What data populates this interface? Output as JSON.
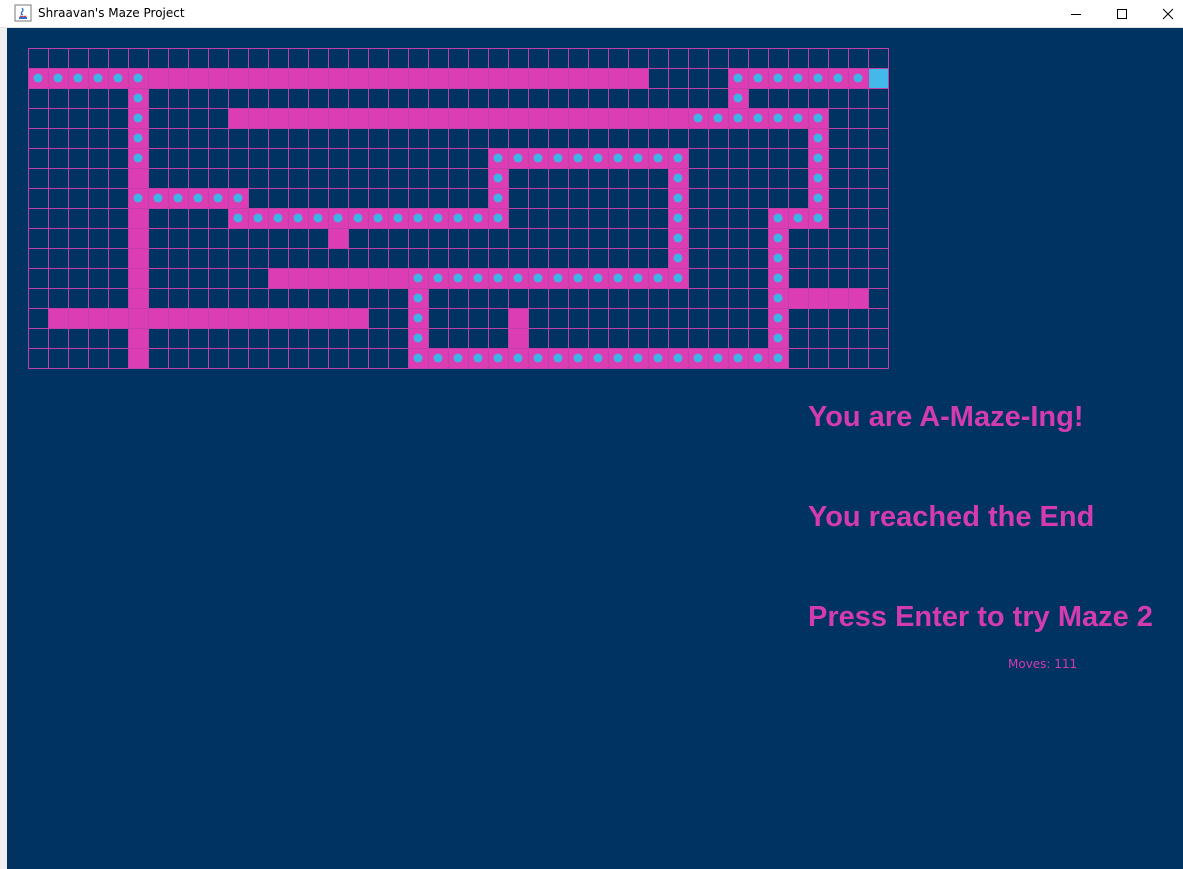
{
  "window": {
    "title": "Shraavan's Maze Project",
    "icon": "java-icon",
    "controls": [
      "minimize-icon",
      "maximize-icon",
      "close-icon"
    ]
  },
  "colors": {
    "background": "#003262",
    "wall": "#dc3cb4",
    "grid": "#c040a8",
    "dot": "#3fb3e6",
    "goal": "#45b8ea",
    "text": "#d43cae"
  },
  "maze": {
    "columns": 43,
    "rows": 16,
    "goal": [
      42,
      1
    ],
    "paths": [
      {
        "row": 1,
        "cols": [
          [
            0,
            30
          ],
          [
            35,
            42
          ]
        ]
      },
      {
        "row": 2,
        "cols": [
          [
            5,
            5
          ],
          [
            35,
            35
          ]
        ]
      },
      {
        "row": 3,
        "cols": [
          [
            5,
            5
          ],
          [
            10,
            39
          ]
        ]
      },
      {
        "row": 4,
        "cols": [
          [
            5,
            5
          ],
          [
            39,
            39
          ]
        ]
      },
      {
        "row": 5,
        "cols": [
          [
            5,
            5
          ],
          [
            23,
            32
          ],
          [
            39,
            39
          ]
        ]
      },
      {
        "row": 6,
        "cols": [
          [
            5,
            5
          ],
          [
            23,
            23
          ],
          [
            32,
            32
          ],
          [
            39,
            39
          ]
        ]
      },
      {
        "row": 7,
        "cols": [
          [
            5,
            10
          ],
          [
            23,
            23
          ],
          [
            32,
            32
          ],
          [
            39,
            39
          ]
        ]
      },
      {
        "row": 8,
        "cols": [
          [
            5,
            5
          ],
          [
            10,
            23
          ],
          [
            32,
            32
          ],
          [
            37,
            39
          ]
        ]
      },
      {
        "row": 9,
        "cols": [
          [
            5,
            5
          ],
          [
            15,
            15
          ],
          [
            32,
            32
          ],
          [
            37,
            37
          ]
        ]
      },
      {
        "row": 10,
        "cols": [
          [
            5,
            5
          ],
          [
            32,
            32
          ],
          [
            37,
            37
          ]
        ]
      },
      {
        "row": 11,
        "cols": [
          [
            5,
            5
          ],
          [
            12,
            32
          ],
          [
            37,
            37
          ]
        ]
      },
      {
        "row": 12,
        "cols": [
          [
            5,
            5
          ],
          [
            19,
            19
          ],
          [
            37,
            41
          ]
        ]
      },
      {
        "row": 13,
        "cols": [
          [
            1,
            16
          ],
          [
            19,
            19
          ],
          [
            24,
            24
          ],
          [
            37,
            37
          ]
        ]
      },
      {
        "row": 14,
        "cols": [
          [
            5,
            5
          ],
          [
            19,
            19
          ],
          [
            24,
            24
          ],
          [
            37,
            37
          ]
        ]
      },
      {
        "row": 15,
        "cols": [
          [
            5,
            5
          ],
          [
            19,
            37
          ]
        ]
      }
    ],
    "trail": [
      {
        "row": 1,
        "cols": [
          [
            0,
            5
          ],
          [
            35,
            41
          ]
        ]
      },
      {
        "row": 2,
        "cols": [
          [
            5,
            5
          ],
          [
            35,
            35
          ]
        ]
      },
      {
        "row": 3,
        "cols": [
          [
            5,
            5
          ],
          [
            33,
            39
          ]
        ]
      },
      {
        "row": 4,
        "cols": [
          [
            5,
            5
          ],
          [
            39,
            39
          ]
        ]
      },
      {
        "row": 5,
        "cols": [
          [
            5,
            5
          ],
          [
            23,
            32
          ],
          [
            39,
            39
          ]
        ]
      },
      {
        "row": 6,
        "cols": [
          [
            23,
            23
          ],
          [
            32,
            32
          ],
          [
            39,
            39
          ]
        ]
      },
      {
        "row": 7,
        "cols": [
          [
            5,
            10
          ],
          [
            23,
            23
          ],
          [
            32,
            32
          ],
          [
            39,
            39
          ]
        ]
      },
      {
        "row": 8,
        "cols": [
          [
            10,
            23
          ],
          [
            32,
            32
          ],
          [
            37,
            39
          ]
        ]
      },
      {
        "row": 9,
        "cols": [
          [
            32,
            32
          ],
          [
            37,
            37
          ]
        ]
      },
      {
        "row": 10,
        "cols": [
          [
            32,
            32
          ],
          [
            37,
            37
          ]
        ]
      },
      {
        "row": 11,
        "cols": [
          [
            19,
            32
          ],
          [
            37,
            37
          ]
        ]
      },
      {
        "row": 12,
        "cols": [
          [
            19,
            19
          ],
          [
            37,
            37
          ]
        ]
      },
      {
        "row": 13,
        "cols": [
          [
            19,
            19
          ],
          [
            37,
            37
          ]
        ]
      },
      {
        "row": 14,
        "cols": [
          [
            19,
            19
          ],
          [
            37,
            37
          ]
        ]
      },
      {
        "row": 15,
        "cols": [
          [
            19,
            37
          ]
        ]
      }
    ]
  },
  "messages": {
    "line1": "You are A-Maze-Ing!",
    "line2": "You reached the End",
    "line3": "Press Enter to try Maze 2"
  },
  "moves": {
    "text": "Moves: 111"
  }
}
